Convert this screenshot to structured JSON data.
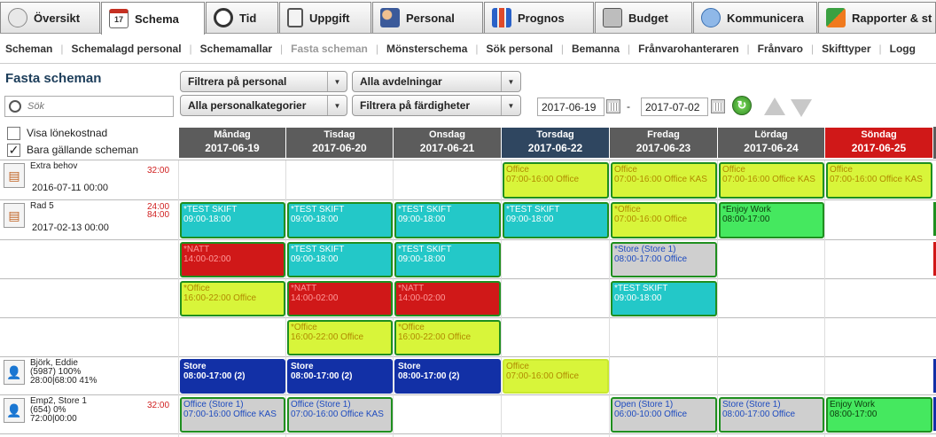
{
  "tabs": [
    {
      "label": "Översikt",
      "icon": "overview-icon"
    },
    {
      "label": "Schema",
      "icon": "calendar-icon",
      "badge": "17"
    },
    {
      "label": "Tid",
      "icon": "clock-icon"
    },
    {
      "label": "Uppgift",
      "icon": "clipboard-icon"
    },
    {
      "label": "Personal",
      "icon": "people-icon"
    },
    {
      "label": "Prognos",
      "icon": "bar-chart-icon"
    },
    {
      "label": "Budget",
      "icon": "calculator-icon"
    },
    {
      "label": "Kommunicera",
      "icon": "chat-icon"
    },
    {
      "label": "Rapporter & st",
      "icon": "report-icon"
    }
  ],
  "subnav": [
    "Scheman",
    "Schemalagd personal",
    "Schemamallar",
    "Fasta scheman",
    "Mönsterschema",
    "Sök personal",
    "Bemanna",
    "Frånvarohanteraren",
    "Frånvaro",
    "Skifttyper",
    "Logg"
  ],
  "page_title": "Fasta scheman",
  "search_placeholder": "Sök",
  "filters": {
    "personal": "Filtrera på personal",
    "departments": "Alla avdelningar",
    "categories": "Alla personalkategorier",
    "skills": "Filtrera på färdigheter",
    "date_from": "2017-06-19",
    "date_sep": "-",
    "date_to": "2017-07-02"
  },
  "checkboxes": [
    {
      "label": "Visa lönekostnad",
      "checked": false,
      "mark": ""
    },
    {
      "label": "Bara gällande scheman",
      "checked": true,
      "mark": "✓"
    }
  ],
  "days": [
    {
      "name": "Måndag",
      "date": "2017-06-19",
      "color": "#5c5c5c"
    },
    {
      "name": "Tisdag",
      "date": "2017-06-20",
      "color": "#5c5c5c"
    },
    {
      "name": "Onsdag",
      "date": "2017-06-21",
      "color": "#5c5c5c"
    },
    {
      "name": "Torsdag",
      "date": "2017-06-22",
      "color": "#2f4660"
    },
    {
      "name": "Fredag",
      "date": "2017-06-23",
      "color": "#5c5c5c"
    },
    {
      "name": "Lördag",
      "date": "2017-06-24",
      "color": "#5c5c5c"
    },
    {
      "name": "Söndag",
      "date": "2017-06-25",
      "color": "#d01818"
    }
  ],
  "employees": [
    {
      "name": "Extra behov",
      "date": "2016-07-11 00:00",
      "hours": "32:00"
    },
    {
      "name": "Rad 5",
      "date": "2017-02-13 00:00",
      "hours": "24:00\n84:00"
    },
    {
      "name": "Björk, Eddie\n(5987) 100%\n28:00|68:00 41%",
      "date": "",
      "hours": ""
    },
    {
      "name": "Emp2, Store 1\n(654) 0%\n72:00|00:00",
      "date": "",
      "hours": "32:00"
    }
  ],
  "shifts": [
    {
      "row": 0,
      "day": 3,
      "l1": "Office",
      "l2": "07:00-16:00 Office",
      "color": "yel"
    },
    {
      "row": 0,
      "day": 4,
      "l1": "Office",
      "l2": "07:00-16:00 Office KAS",
      "color": "yel"
    },
    {
      "row": 0,
      "day": 5,
      "l1": "Office",
      "l2": "07:00-16:00 Office KAS",
      "color": "yel"
    },
    {
      "row": 0,
      "day": 6,
      "l1": "Office",
      "l2": "07:00-16:00 Office KAS",
      "color": "yel"
    },
    {
      "row": 1,
      "day": 0,
      "l1": "*TEST SKIFT",
      "l2": "09:00-18:00",
      "color": "cyan"
    },
    {
      "row": 1,
      "day": 1,
      "l1": "*TEST SKIFT",
      "l2": "09:00-18:00",
      "color": "cyan"
    },
    {
      "row": 1,
      "day": 2,
      "l1": "*TEST SKIFT",
      "l2": "09:00-18:00",
      "color": "cyan"
    },
    {
      "row": 1,
      "day": 3,
      "l1": "*TEST SKIFT",
      "l2": "09:00-18:00",
      "color": "cyan"
    },
    {
      "row": 1,
      "day": 4,
      "l1": "*Office",
      "l2": "07:00-16:00 Office",
      "color": "yel"
    },
    {
      "row": 1,
      "day": 5,
      "l1": "*Enjoy Work",
      "l2": "08:00-17:00",
      "color": "green"
    },
    {
      "row": 2,
      "day": 0,
      "l1": "*NATT",
      "l2": "14:00-02:00",
      "color": "red"
    },
    {
      "row": 2,
      "day": 1,
      "l1": "*TEST SKIFT",
      "l2": "09:00-18:00",
      "color": "cyan"
    },
    {
      "row": 2,
      "day": 2,
      "l1": "*TEST SKIFT",
      "l2": "09:00-18:00",
      "color": "cyan"
    },
    {
      "row": 2,
      "day": 4,
      "l1": "*Store (Store 1)",
      "l2": "08:00-17:00 Office",
      "color": "gray"
    },
    {
      "row": 3,
      "day": 0,
      "l1": "*Office",
      "l2": "16:00-22:00 Office",
      "color": "yel"
    },
    {
      "row": 3,
      "day": 1,
      "l1": "*NATT",
      "l2": "14:00-02:00",
      "color": "red"
    },
    {
      "row": 3,
      "day": 2,
      "l1": "*NATT",
      "l2": "14:00-02:00",
      "color": "red"
    },
    {
      "row": 3,
      "day": 4,
      "l1": "*TEST SKIFT",
      "l2": "09:00-18:00",
      "color": "cyan"
    },
    {
      "row": 4,
      "day": 1,
      "l1": "*Office",
      "l2": "16:00-22:00 Office",
      "color": "yel"
    },
    {
      "row": 4,
      "day": 2,
      "l1": "*Office",
      "l2": "16:00-22:00 Office",
      "color": "yel"
    },
    {
      "row": 5,
      "day": 0,
      "l1": "Store",
      "l2": "08:00-17:00 (2)",
      "color": "blue"
    },
    {
      "row": 5,
      "day": 1,
      "l1": "Store",
      "l2": "08:00-17:00 (2)",
      "color": "blue"
    },
    {
      "row": 5,
      "day": 2,
      "l1": "Store",
      "l2": "08:00-17:00 (2)",
      "color": "blue"
    },
    {
      "row": 5,
      "day": 3,
      "l1": "Office",
      "l2": "07:00-16:00 Office",
      "color": "yelb"
    },
    {
      "row": 6,
      "day": 0,
      "l1": "Office (Store 1)",
      "l2": "07:00-16:00 Office KAS",
      "color": "gray"
    },
    {
      "row": 6,
      "day": 1,
      "l1": "Office (Store 1)",
      "l2": "07:00-16:00 Office KAS",
      "color": "gray"
    },
    {
      "row": 6,
      "day": 4,
      "l1": "Open (Store 1)",
      "l2": "06:00-10:00 Office",
      "color": "gray"
    },
    {
      "row": 6,
      "day": 5,
      "l1": "Store (Store 1)",
      "l2": "08:00-17:00 Office",
      "color": "gray"
    },
    {
      "row": 6,
      "day": 6,
      "l1": "Enjoy Work",
      "l2": "08:00-17:00",
      "color": "green"
    }
  ]
}
